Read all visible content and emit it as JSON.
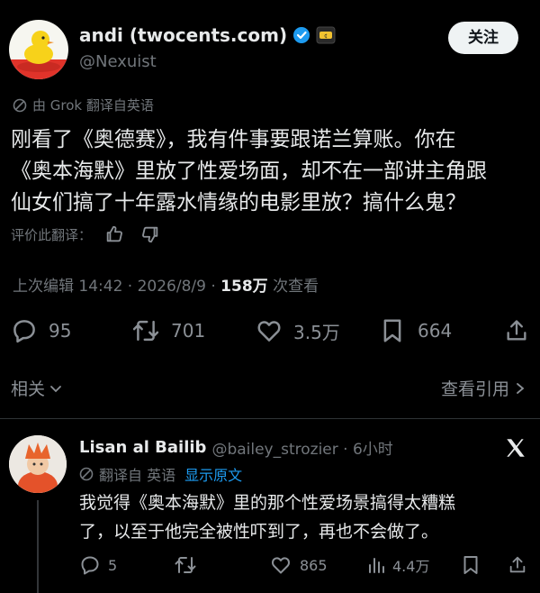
{
  "main_tweet": {
    "author_name": "andi (twocents.com)",
    "handle": "@Nexuist",
    "follow_label": "关注",
    "translation_note": "由 Grok 翻译自英语",
    "text_lines": [
      "刚看了《奥德赛》，我有件事要跟诺兰算账。你在",
      "《奥本海默》里放了性爱场面，却不在一部讲主角跟",
      "仙女们搞了十年露水情缘的电影里放？搞什么鬼？"
    ],
    "rate_translation": "评价此翻译：",
    "meta_prefix": "上次编辑 14:42 · 2026/8/9 · ",
    "views_count": "158万",
    "views_label": " 次查看",
    "stats": {
      "replies": "95",
      "retweets": "701",
      "likes": "3.5万",
      "bookmarks": "664"
    },
    "related_label": "相关",
    "view_quotes_label": "查看引用"
  },
  "reply": {
    "author_name": "Lisan al Bailib",
    "handle_time": "@bailey_strozier · 6小时",
    "translation_note": "翻译自 英语",
    "show_original": "显示原文",
    "text_lines": [
      "我觉得《奥本海默》里的那个性爱场景搞得太糟糕",
      "了，以至于他完全被性吓到了，再也不会做了。"
    ],
    "stats": {
      "replies": "5",
      "likes": "865",
      "views": "4.4万"
    }
  },
  "colors": {
    "background": "#000000",
    "text": "#e7e9ea",
    "muted": "#71767b",
    "link": "#1d9bf0",
    "verified": "#1d9bf0"
  },
  "icons": [
    "grok-slash-icon",
    "verified-badge-icon",
    "affiliate-badge-icon",
    "thumbs-up-icon",
    "thumbs-down-icon",
    "reply-icon",
    "retweet-icon",
    "like-icon",
    "bookmark-icon",
    "share-icon",
    "chevron-down-icon",
    "chevron-right-icon",
    "x-logo-icon",
    "views-icon"
  ]
}
